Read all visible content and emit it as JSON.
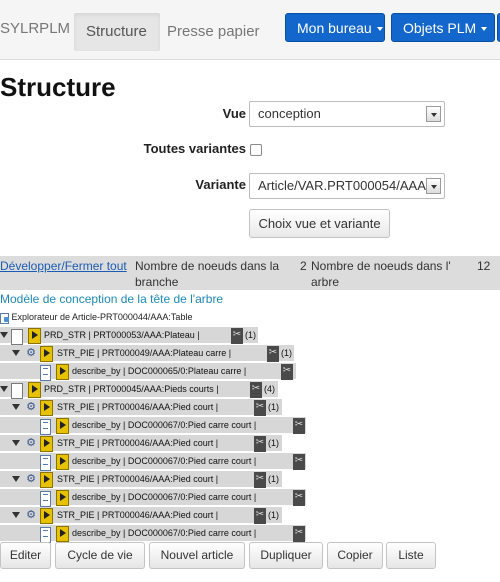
{
  "navbar": {
    "brand": "SYLRPLM",
    "tabs": [
      {
        "label": "Structure"
      },
      {
        "label": "Presse papier"
      }
    ],
    "buttons": [
      {
        "label": "Mon bureau"
      },
      {
        "label": "Objets PLM"
      }
    ]
  },
  "page": {
    "title": "Structure"
  },
  "form": {
    "vue_label": "Vue",
    "vue_value": "conception",
    "variantes_label": "Toutes variantes",
    "variante_label": "Variante",
    "variante_value": "Article/VAR.PRT000054/AAA",
    "submit_label": "Choix vue et variante"
  },
  "tree_header": {
    "toggle_label": "Développer/Fermer tout",
    "col1": "Nombre de noeuds dans la branche",
    "col2_count": "2",
    "col2": "Nombre de noeuds dans l' arbre",
    "col3_count": "12"
  },
  "tree": {
    "model_title": "Modèle de conception de la tête de l'arbre",
    "explorer": "Explorateur de Article-PRT000044/AAA:Table",
    "rows": [
      {
        "text": "PRD_STR | PRT000053/AAA:Plateau |",
        "count": "(1)"
      },
      {
        "text": "STR_PIE | PRT000049/AAA:Plateau carre |",
        "count": "(1)"
      },
      {
        "text": "describe_by | DOC000065/0:Plateau carre |"
      },
      {
        "text": "PRD_STR | PRT000045/AAA:Pieds courts |",
        "count": "(4)"
      },
      {
        "text": "STR_PIE | PRT000046/AAA:Pied court |",
        "count": "(1)"
      },
      {
        "text": "describe_by | DOC000067/0:Pied carre court |"
      },
      {
        "text": "STR_PIE | PRT000046/AAA:Pied court |",
        "count": "(1)"
      },
      {
        "text": "describe_by | DOC000067/0:Pied carre court |"
      },
      {
        "text": "STR_PIE | PRT000046/AAA:Pied court |",
        "count": "(1)"
      },
      {
        "text": "describe_by | DOC000067/0:Pied carre court |"
      },
      {
        "text": "STR_PIE | PRT000046/AAA:Pied court |",
        "count": "(1)"
      },
      {
        "text": "describe_by | DOC000067/0:Pied carre court |"
      }
    ]
  },
  "actions": {
    "buttons": [
      {
        "label": "Editer"
      },
      {
        "label": "Cycle de vie"
      },
      {
        "label": "Nouvel article"
      },
      {
        "label": "Dupliquer"
      },
      {
        "label": "Copier"
      },
      {
        "label": "Liste"
      }
    ]
  }
}
